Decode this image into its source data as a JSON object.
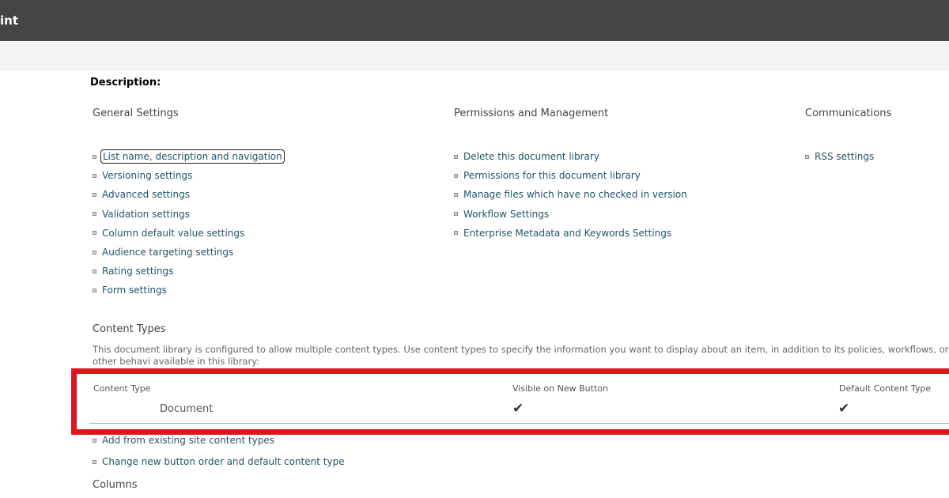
{
  "header": {
    "app_title": "int"
  },
  "page": {
    "description_label": "Description:"
  },
  "general_settings": {
    "heading": "General Settings",
    "items": [
      {
        "label": "List name, description and navigation"
      },
      {
        "label": "Versioning settings"
      },
      {
        "label": "Advanced settings"
      },
      {
        "label": "Validation settings"
      },
      {
        "label": "Column default value settings"
      },
      {
        "label": "Audience targeting settings"
      },
      {
        "label": "Rating settings"
      },
      {
        "label": "Form settings"
      }
    ]
  },
  "permissions_management": {
    "heading": "Permissions and Management",
    "items": [
      {
        "label": "Delete this document library"
      },
      {
        "label": "Permissions for this document library"
      },
      {
        "label": "Manage files which have no checked in version"
      },
      {
        "label": "Workflow Settings"
      },
      {
        "label": "Enterprise Metadata and Keywords Settings"
      }
    ]
  },
  "communications": {
    "heading": "Communications",
    "items": [
      {
        "label": "RSS settings"
      }
    ]
  },
  "content_types": {
    "heading": "Content Types",
    "description": "This document library is configured to allow multiple content types. Use content types to specify the information you want to display about an item, in addition to its policies, workflows, or other behavi available in this library:",
    "columns": [
      "Content Type",
      "Visible on New Button",
      "Default Content Type"
    ],
    "rows": [
      {
        "name": "Document",
        "visible_on_new": "✔",
        "default": "✔"
      }
    ],
    "links": [
      {
        "label": "Add from existing site content types"
      },
      {
        "label": "Change new button order and default content type"
      }
    ]
  },
  "columns_section": {
    "heading": "Columns"
  },
  "colors": {
    "suite_bar": "#444444",
    "link": "#21566b",
    "highlight": "#e0141b"
  }
}
